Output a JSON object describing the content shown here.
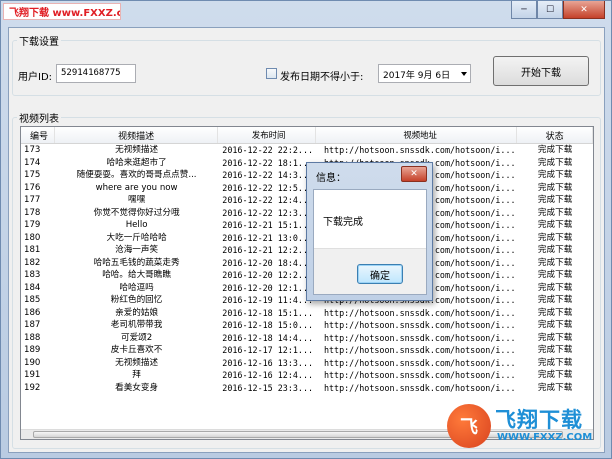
{
  "titlebar": {
    "logo_text": "飞翔下载 www.FXXZ.com",
    "min_glyph": "─",
    "max_glyph": "☐",
    "close_glyph": "✕"
  },
  "settings": {
    "group_label": "下载设置",
    "user_id_label": "用户ID:",
    "user_id_value": "52914168775",
    "date_filter_label": "发布日期不得小于:",
    "date_filter_checked": false,
    "date_value": "2017年 9月 6日",
    "start_button": "开始下载"
  },
  "video_list": {
    "group_label": "视频列表",
    "columns": [
      "编号",
      "视频描述",
      "发布时间",
      "视频地址",
      "状态"
    ],
    "rows": [
      [
        "173",
        "无视频描述",
        "2016-12-22 22:2...",
        "http://hotsoon.snssdk.com/hotsoon/i...",
        "完成下载"
      ],
      [
        "174",
        "哈哈来逛超市了",
        "2016-12-22 18:1...",
        "http://hotsoon.snssdk.com/hotsoon/i...",
        "完成下载"
      ],
      [
        "175",
        "随便耍耍。喜欢的哥哥点点赞...",
        "2016-12-22 14:3...",
        "http://hotsoon.snssdk.com/hotsoon/i...",
        "完成下载"
      ],
      [
        "176",
        "where are you now",
        "2016-12-22 12:5...",
        "http://hotsoon.snssdk.com/hotsoon/i...",
        "完成下载"
      ],
      [
        "177",
        "嘿嘿",
        "2016-12-22 12:4...",
        "http://hotsoon.snssdk.com/hotsoon/i...",
        "完成下载"
      ],
      [
        "178",
        "你觉不觉得你好过分哦",
        "2016-12-22 12:3...",
        "http://hotsoon.snssdk.com/hotsoon/i...",
        "完成下载"
      ],
      [
        "179",
        "Hello",
        "2016-12-21 15:1...",
        "http://hotsoon.snssdk.com/hotsoon/i...",
        "完成下载"
      ],
      [
        "180",
        "大吃一斤哈哈哈",
        "2016-12-21 13:0...",
        "http://hotsoon.snssdk.com/hotsoon/i...",
        "完成下载"
      ],
      [
        "181",
        "沧海一声笑",
        "2016-12-21 12:2...",
        "http://hotsoon.snssdk.com/hotsoon/i...",
        "完成下载"
      ],
      [
        "182",
        "哈哈五毛钱的蔬菜走秀",
        "2016-12-20 18:4...",
        "http://hotsoon.snssdk.com/hotsoon/i...",
        "完成下载"
      ],
      [
        "183",
        "哈哈。给大哥瞧瞧",
        "2016-12-20 12:2...",
        "http://hotsoon.snssdk.com/hotsoon/i...",
        "完成下载"
      ],
      [
        "184",
        "哈哈逗吗",
        "2016-12-20 12:1...",
        "http://hotsoon.snssdk.com/hotsoon/i...",
        "完成下载"
      ],
      [
        "185",
        "粉红色的回忆",
        "2016-12-19 11:4...",
        "http://hotsoon.snssdk.com/hotsoon/i...",
        "完成下载"
      ],
      [
        "186",
        "亲爱的姑娘",
        "2016-12-18 15:1...",
        "http://hotsoon.snssdk.com/hotsoon/i...",
        "完成下载"
      ],
      [
        "187",
        "老司机带带我",
        "2016-12-18 15:0...",
        "http://hotsoon.snssdk.com/hotsoon/i...",
        "完成下载"
      ],
      [
        "188",
        "可爱颂2",
        "2016-12-18 14:4...",
        "http://hotsoon.snssdk.com/hotsoon/i...",
        "完成下载"
      ],
      [
        "189",
        "皮卡丘喜欢不",
        "2016-12-17 12:1...",
        "http://hotsoon.snssdk.com/hotsoon/i...",
        "完成下载"
      ],
      [
        "190",
        "无视频描述",
        "2016-12-16 13:3...",
        "http://hotsoon.snssdk.com/hotsoon/i...",
        "完成下载"
      ],
      [
        "191",
        "拜",
        "2016-12-16 12:4...",
        "http://hotsoon.snssdk.com/hotsoon/i...",
        "完成下载"
      ],
      [
        "192",
        "看美女变身",
        "2016-12-15 23:3...",
        "http://hotsoon.snssdk.com/hotsoon/i...",
        "完成下载"
      ]
    ]
  },
  "dialog": {
    "title": "信息：",
    "message": "下载完成",
    "ok_button": "确定",
    "close_glyph": "✕"
  },
  "watermark": {
    "logo_glyph": "飞",
    "brand": "飞翔下载",
    "url": "WWW.FXXZ.COM"
  }
}
